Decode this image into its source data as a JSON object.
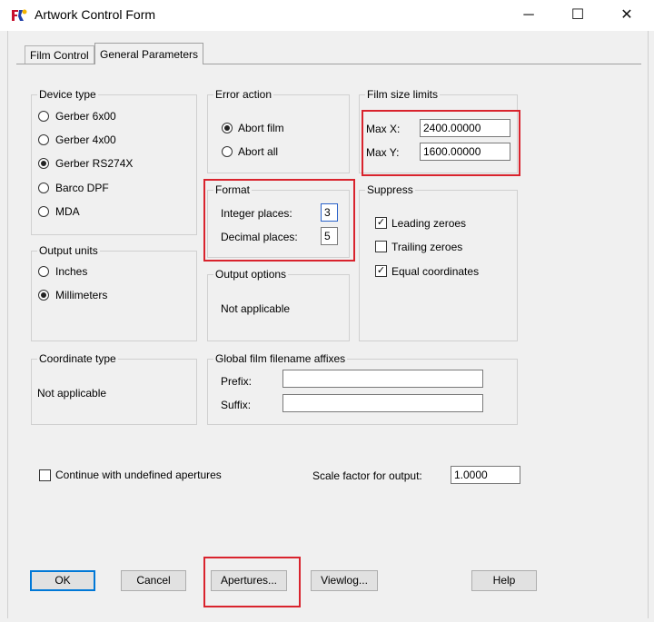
{
  "window": {
    "title": "Artwork Control Form",
    "minimize": "─",
    "maximize": "☐",
    "close": "✕"
  },
  "tabs": [
    {
      "label": "Film Control"
    },
    {
      "label": "General Parameters"
    }
  ],
  "device_type": {
    "label": "Device type",
    "options": [
      {
        "label": "Gerber 6x00",
        "selected": false
      },
      {
        "label": "Gerber 4x00",
        "selected": false
      },
      {
        "label": "Gerber RS274X",
        "selected": true
      },
      {
        "label": "Barco DPF",
        "selected": false
      },
      {
        "label": "MDA",
        "selected": false
      }
    ]
  },
  "output_units": {
    "label": "Output units",
    "options": [
      {
        "label": "Inches",
        "selected": false
      },
      {
        "label": "Millimeters",
        "selected": true
      }
    ]
  },
  "coordinate_type": {
    "label": "Coordinate type",
    "value": "Not applicable"
  },
  "error_action": {
    "label": "Error action",
    "options": [
      {
        "label": "Abort film",
        "selected": true
      },
      {
        "label": "Abort all",
        "selected": false
      }
    ]
  },
  "format": {
    "label": "Format",
    "integer_label": "Integer places:",
    "integer_value": "3",
    "decimal_label": "Decimal places:",
    "decimal_value": "5"
  },
  "output_options": {
    "label": "Output options",
    "value": "Not applicable"
  },
  "global_affixes": {
    "label": "Global film filename affixes",
    "prefix_label": "Prefix:",
    "prefix_value": "",
    "suffix_label": "Suffix:",
    "suffix_value": ""
  },
  "film_size": {
    "label": "Film size limits",
    "maxx_label": "Max X:",
    "maxx_value": "2400.00000",
    "maxy_label": "Max Y:",
    "maxy_value": "1600.00000"
  },
  "suppress": {
    "label": "Suppress",
    "options": [
      {
        "label": "Leading zeroes",
        "checked": true
      },
      {
        "label": "Trailing zeroes",
        "checked": false
      },
      {
        "label": "Equal coordinates",
        "checked": true
      }
    ]
  },
  "continue_undefined": {
    "label": "Continue with undefined apertures",
    "checked": false
  },
  "scale_factor": {
    "label": "Scale factor for output:",
    "value": "1.0000"
  },
  "buttons": {
    "ok": "OK",
    "cancel": "Cancel",
    "apertures": "Apertures...",
    "viewlog": "Viewlog...",
    "help": "Help"
  },
  "colors": {
    "highlight": "#d9232d",
    "focus_border": "#2a62c9"
  }
}
